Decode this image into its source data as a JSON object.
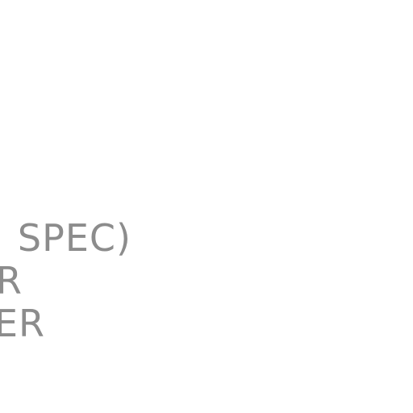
{
  "text_lines": [
    "SPEC)",
    "R",
    "ER"
  ],
  "colors": {
    "text": "#8c8c8c",
    "background": "#ffffff"
  }
}
